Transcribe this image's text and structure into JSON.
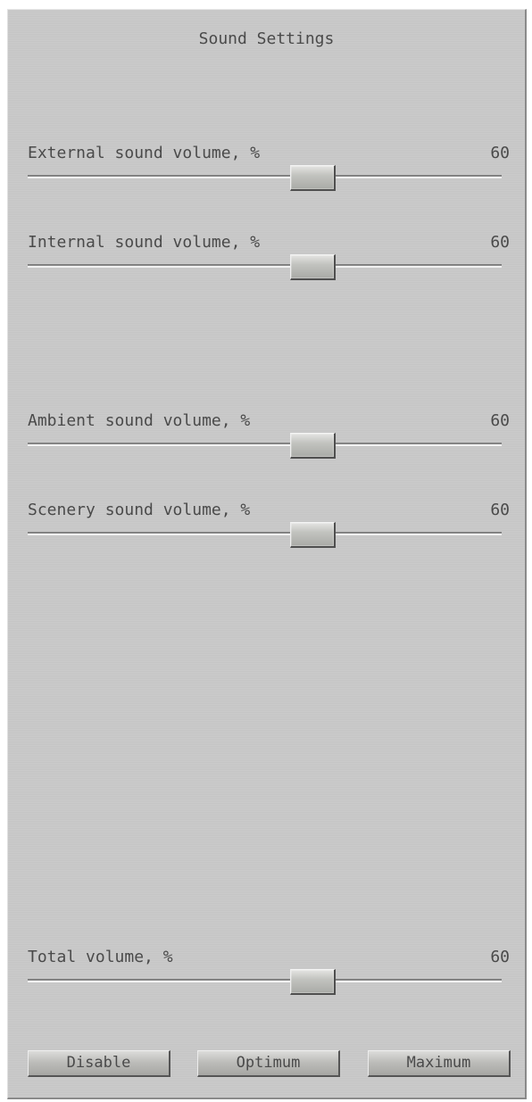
{
  "window": {
    "title": "Sound Settings"
  },
  "sliders": [
    {
      "label": "External sound volume, %",
      "value": "60",
      "level": 0.6
    },
    {
      "label": "Internal sound volume, %",
      "value": "60",
      "level": 0.6
    },
    {
      "label": "Ambient sound volume, %",
      "value": "60",
      "level": 0.6
    },
    {
      "label": "Scenery sound volume, %",
      "value": "60",
      "level": 0.6
    },
    {
      "label": "Total volume, %",
      "value": "60",
      "level": 0.6
    }
  ],
  "buttons": {
    "disable": "Disable",
    "optimum": "Optimum",
    "maximum": "Maximum"
  }
}
